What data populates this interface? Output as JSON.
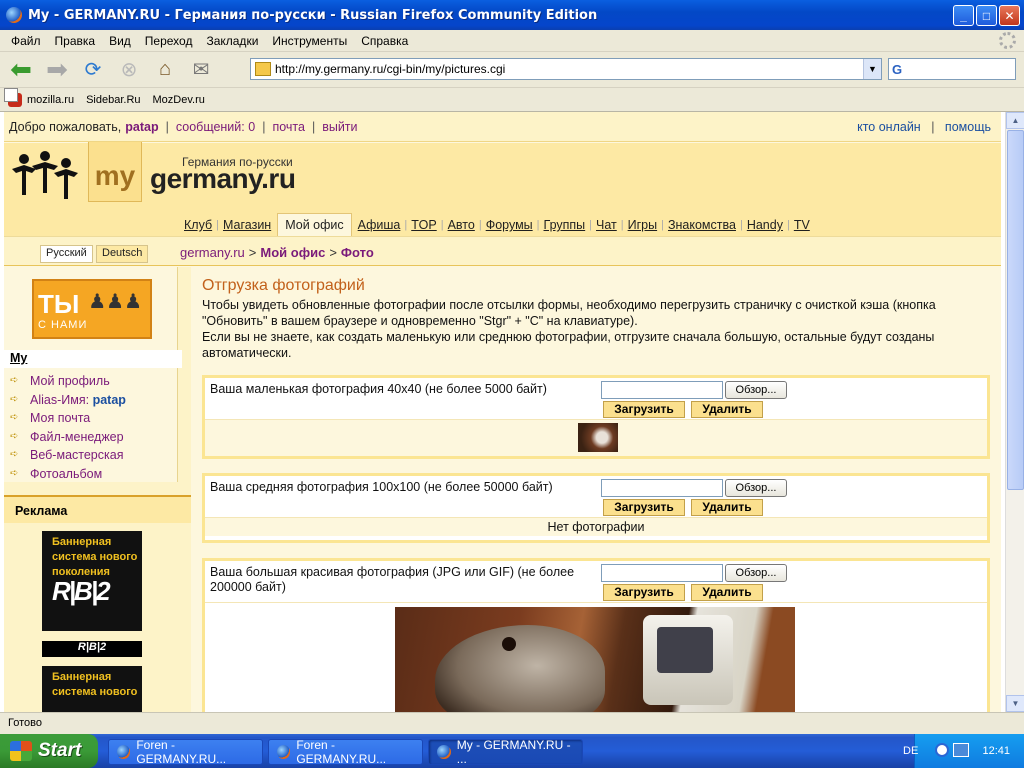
{
  "window": {
    "title": "My - GERMANY.RU - Германия по-русски - Russian Firefox Community Edition",
    "min": "_",
    "max": "□",
    "close": "✕"
  },
  "menu": [
    "Файл",
    "Правка",
    "Вид",
    "Переход",
    "Закладки",
    "Инструменты",
    "Справка"
  ],
  "toolbar": {
    "url": "http://my.germany.ru/cgi-bin/my/pictures.cgi",
    "search_placeholder": "G"
  },
  "bookmarks": [
    "mozilla.ru",
    "Sidebar.Ru",
    "MozDev.ru"
  ],
  "site": {
    "welcome": "Добро пожаловать,",
    "username": "patap",
    "messages": "сообщений: 0",
    "mail": "почта",
    "logout": "выйти",
    "who_online": "кто онлайн",
    "help": "помощь",
    "logo_my": "my",
    "logo_germany": "germany.ru",
    "tagline": "Германия по-русски",
    "nav": [
      "Клуб",
      "Магазин",
      "Мой офис",
      "Афиша",
      "TOP",
      "Авто",
      "Форумы",
      "Группы",
      "Чат",
      "Игры",
      "Знакомства",
      "Handy",
      "TV"
    ],
    "nav_active_index": 2,
    "lang_ru": "Русский",
    "lang_de": "Deutsch",
    "crumbs": [
      "germany.ru",
      "Мой офис",
      "Фото"
    ]
  },
  "sidebar": {
    "banner_big": "ТЫ",
    "banner_small": "С НАМИ",
    "menu_title": "My",
    "items": [
      {
        "label": "Мой профиль"
      },
      {
        "label": "Alias-Имя:",
        "value": "patap"
      },
      {
        "label": "Моя почта"
      },
      {
        "label": "Файл-менеджер"
      },
      {
        "label": "Веб-мастерская"
      },
      {
        "label": "Фотоальбом"
      }
    ],
    "ads_title": "Реклама",
    "ad1_text": "Баннерная система нового поколения",
    "ad1_logo": "R|B|2",
    "ad_strip": "R|B|2",
    "ad2_text": "Баннерная система нового"
  },
  "content": {
    "title": "Отгрузка фотографий",
    "para1": "Чтобы увидеть обновленные фотографии после отсылки формы, необходимо перегрузить страничку с очисткой кэша (кнопка \"Обновить\" в вашем браузере и одновременно \"Stgr\" + \"C\" на клавиатуре).",
    "para2": "Если вы не знаете, как создать маленькую или среднюю фотографии, отгрузите сначала большую, остальные будут созданы автоматически.",
    "browse": "Обзор...",
    "upload": "Загрузить",
    "delete": "Удалить",
    "small_label": "Ваша маленькая фотография 40x40 (не более 5000 байт)",
    "medium_label": "Ваша средняя фотография 100x100 (не более 50000 байт)",
    "medium_nophoto": "Нет фотографии",
    "large_label": "Ваша большая красивая фотография (JPG или GIF) (не более 200000 байт)"
  },
  "status": "Готово",
  "taskbar": {
    "start": "Start",
    "tasks": [
      "Foren - GERMANY.RU...",
      "Foren - GERMANY.RU...",
      "My - GERMANY.RU - ..."
    ],
    "lang": "DE",
    "clock": "12:41"
  }
}
